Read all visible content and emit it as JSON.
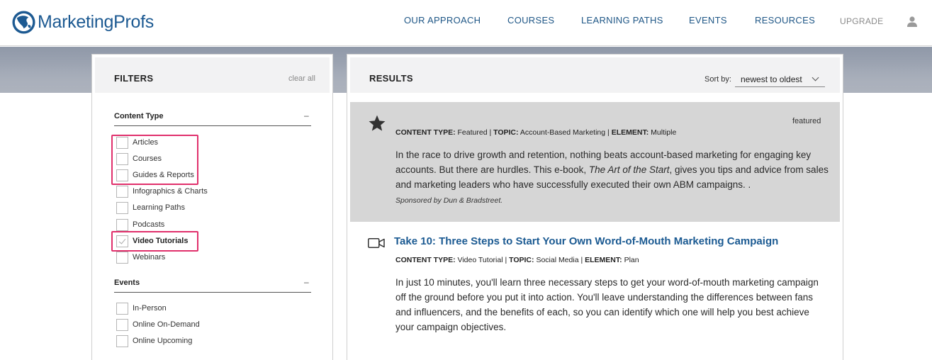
{
  "brand": {
    "name": "MarketingProfs",
    "color": "#1d5a92"
  },
  "nav": {
    "items": [
      "OUR APPROACH",
      "COURSES",
      "LEARNING PATHS",
      "EVENTS",
      "RESOURCES"
    ],
    "upgrade": "UPGRADE",
    "user_icon": "user-icon"
  },
  "filters": {
    "title": "FILTERS",
    "clear_all": "clear all",
    "content_type": {
      "title": "Content Type",
      "toggle": "–",
      "options": [
        {
          "label": "Articles",
          "checked": false
        },
        {
          "label": "Courses",
          "checked": false
        },
        {
          "label": "Guides & Reports",
          "checked": false
        },
        {
          "label": "Infographics & Charts",
          "checked": false
        },
        {
          "label": "Learning Paths",
          "checked": false
        },
        {
          "label": "Podcasts",
          "checked": false
        },
        {
          "label": "Video Tutorials",
          "checked": true
        },
        {
          "label": "Webinars",
          "checked": false
        }
      ]
    },
    "events": {
      "title": "Events",
      "toggle": "–",
      "options": [
        {
          "label": "In-Person",
          "checked": false
        },
        {
          "label": "Online On-Demand",
          "checked": false
        },
        {
          "label": "Online Upcoming",
          "checked": false
        }
      ]
    },
    "highlight_color": "#e0306c"
  },
  "results": {
    "title": "RESULTS",
    "sort_label": "Sort by:",
    "sort_value": "newest to oldest",
    "featured": {
      "tag": "featured",
      "icon": "star-icon",
      "meta": {
        "content_type_label": "CONTENT TYPE:",
        "content_type": "Featured",
        "topic_label": "TOPIC:",
        "topic": "Account-Based Marketing",
        "element_label": "ELEMENT:",
        "element": "Multiple",
        "sep": "|"
      },
      "desc_before": "In the race to drive growth and retention, nothing beats account-based marketing for engaging key accounts. But there are hurdles. This e-book, ",
      "desc_italic": "The Art of the Start",
      "desc_after": ", gives you tips and advice from sales and marketing leaders who have successfully executed their own ABM campaigns. .",
      "sponsor": "Sponsored by Dun & Bradstreet."
    },
    "item": {
      "icon": "video-camera-icon",
      "title": "Take 10: Three Steps to Start Your Own Word-of-Mouth Marketing Campaign",
      "meta": {
        "content_type_label": "CONTENT TYPE:",
        "content_type": "Video Tutorial",
        "topic_label": "TOPIC:",
        "topic": "Social Media",
        "element_label": "ELEMENT:",
        "element": "Plan",
        "sep": "|"
      },
      "desc": "In just 10 minutes, you'll learn three necessary steps to get your word-of-mouth marketing campaign off the ground before you put it into action. You'll leave understanding the differences between fans and influencers, and the benefits of each, so you can identify which one will help you best achieve your campaign objectives."
    }
  }
}
